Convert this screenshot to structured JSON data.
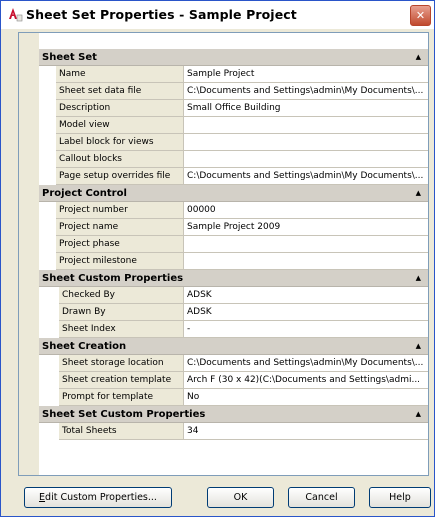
{
  "window": {
    "title": "Sheet Set Properties - Sample Project",
    "close_glyph": "✕"
  },
  "sections": [
    {
      "title": "Sheet Set",
      "rows": [
        {
          "label": "Name",
          "value": "Sample Project"
        },
        {
          "label": "Sheet set data file",
          "value": "C:\\Documents and Settings\\admin\\My Documents\\..."
        },
        {
          "label": "Description",
          "value": "Small Office Building"
        },
        {
          "label": "Model view",
          "value": ""
        },
        {
          "label": "Label block for views",
          "value": ""
        },
        {
          "label": "Callout blocks",
          "value": ""
        },
        {
          "label": "Page setup overrides file",
          "value": "C:\\Documents and Settings\\admin\\My Documents\\..."
        }
      ]
    },
    {
      "title": "Project Control",
      "rows": [
        {
          "label": "Project number",
          "value": "00000"
        },
        {
          "label": "Project name",
          "value": "Sample Project 2009"
        },
        {
          "label": "Project phase",
          "value": ""
        },
        {
          "label": "Project milestone",
          "value": ""
        }
      ]
    },
    {
      "title": "Sheet Custom Properties",
      "rows": [
        {
          "label": "Checked By",
          "value": "ADSK"
        },
        {
          "label": "Drawn By",
          "value": "ADSK"
        },
        {
          "label": "Sheet Index",
          "value": "-"
        }
      ]
    },
    {
      "title": "Sheet Creation",
      "rows": [
        {
          "label": "Sheet storage location",
          "value": "C:\\Documents and Settings\\admin\\My Documents\\..."
        },
        {
          "label": "Sheet creation template",
          "value": "Arch F (30 x 42)(C:\\Documents and Settings\\admi..."
        },
        {
          "label": "Prompt for template",
          "value": "No"
        }
      ]
    },
    {
      "title": "Sheet Set Custom Properties",
      "rows": [
        {
          "label": "Total Sheets",
          "value": "34"
        }
      ]
    }
  ],
  "section_collapse_glyph": "▲",
  "buttons": {
    "edit": "Edit Custom Properties...",
    "ok": "OK",
    "cancel": "Cancel",
    "help": "Help"
  },
  "colors": {
    "title_bar": "#ffffff",
    "dialog_bg": "#ece9d8",
    "section_header": "#d4d0c8",
    "close_button": "#c04a2e",
    "border": "#2a55c9"
  }
}
